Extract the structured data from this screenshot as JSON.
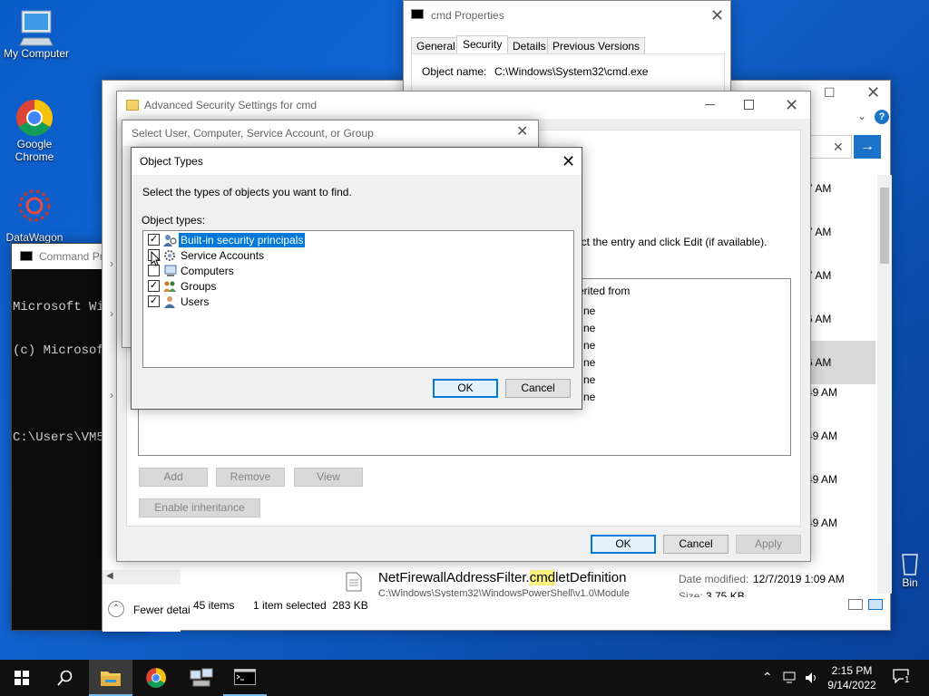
{
  "desktop": {
    "icons": [
      {
        "label": "My Computer"
      },
      {
        "label": "Google Chrome"
      },
      {
        "label": "DataWagon"
      },
      {
        "label": "Bin"
      }
    ]
  },
  "cmd_window": {
    "title": "Command Pr",
    "lines": [
      "Microsoft Wi",
      "(c) Microsoft",
      "",
      "C:\\Users\\VM5"
    ]
  },
  "explorer": {
    "fewer_details": "Fewer detai",
    "status_items": "45 items",
    "status_selected": "1 item selected  283 KB",
    "time_column": [
      "7 AM",
      "7 AM",
      "7 AM",
      "6 AM",
      "6 AM",
      "49 AM",
      "49 AM",
      "49 AM",
      "49 AM"
    ],
    "file_name_prefix": "NetFirewallAddressFilter.",
    "file_name_highlight": "cmd",
    "file_name_suffix": "letDefinition",
    "file_path": "C:\\Windows\\System32\\WindowsPowerShell\\v1.0\\Module",
    "date_modified_label": "Date modified:",
    "date_modified_value": "12/7/2019 1:09 AM",
    "size_label": "Size:",
    "size_value": "3.75 KB"
  },
  "cmd_properties": {
    "title": "cmd Properties",
    "tabs": [
      "General",
      "Security",
      "Details",
      "Previous Versions"
    ],
    "active_tab": "Security",
    "object_name_label": "Object name:",
    "object_name_value": "C:\\Windows\\System32\\cmd.exe"
  },
  "advanced_security": {
    "title": "Advanced Security Settings for cmd",
    "instruction_fragment": "ect the entry and click Edit (if available).",
    "inherited_header": "erited from",
    "rows": [
      "ne",
      "ne",
      "ne",
      "ne",
      "ne",
      "ne"
    ],
    "add": "Add",
    "remove": "Remove",
    "view": "View",
    "enable_inheritance": "Enable inheritance",
    "ok": "OK",
    "cancel": "Cancel",
    "apply": "Apply"
  },
  "select_user": {
    "title": "Select User, Computer, Service Account, or Group"
  },
  "object_types": {
    "title": "Object Types",
    "instruction": "Select the types of objects you want to find.",
    "list_label": "Object types:",
    "items": [
      {
        "label": "Built-in security principals",
        "checked": true,
        "selected": true,
        "icon": "security-principals-icon"
      },
      {
        "label": "Service Accounts",
        "checked": false,
        "selected": false,
        "icon": "service-accounts-icon"
      },
      {
        "label": "Computers",
        "checked": false,
        "selected": false,
        "icon": "computer-icon"
      },
      {
        "label": "Groups",
        "checked": true,
        "selected": false,
        "icon": "groups-icon"
      },
      {
        "label": "Users",
        "checked": true,
        "selected": false,
        "icon": "user-icon"
      }
    ],
    "ok": "OK",
    "cancel": "Cancel"
  },
  "taskbar": {
    "time": "2:15 PM",
    "date": "9/14/2022",
    "notification_count": "1"
  },
  "colors": {
    "selection": "#0078d7",
    "desktop": "#0a5cc7",
    "taskbar": "#101010"
  }
}
